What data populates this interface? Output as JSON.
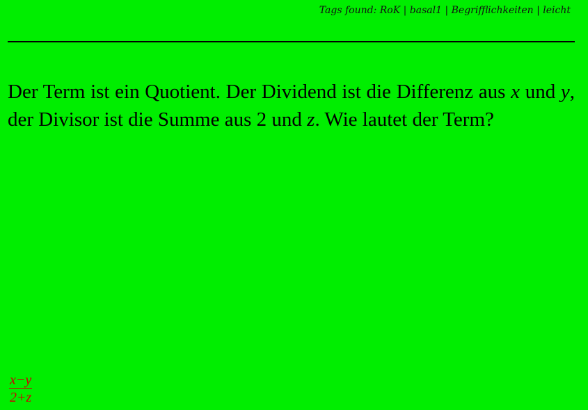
{
  "header": {
    "tags_text": "Tags found: RoK | basal1 | Begrifflichkeiten | leicht"
  },
  "question": {
    "part1": "Der Term ist ein Quotient. Der Dividend ist die Differenz aus ",
    "var_x": "x",
    "part2": " und ",
    "var_y": "y",
    "part3": ", der Divisor ist die Summe aus 2 und ",
    "var_z": "z",
    "part4": ". Wie lautet der Term?"
  },
  "answer": {
    "numerator": "x−y",
    "denominator": "2+z",
    "color": "#cc0000"
  },
  "colors": {
    "background": "#00ee00",
    "text": "#000000"
  }
}
